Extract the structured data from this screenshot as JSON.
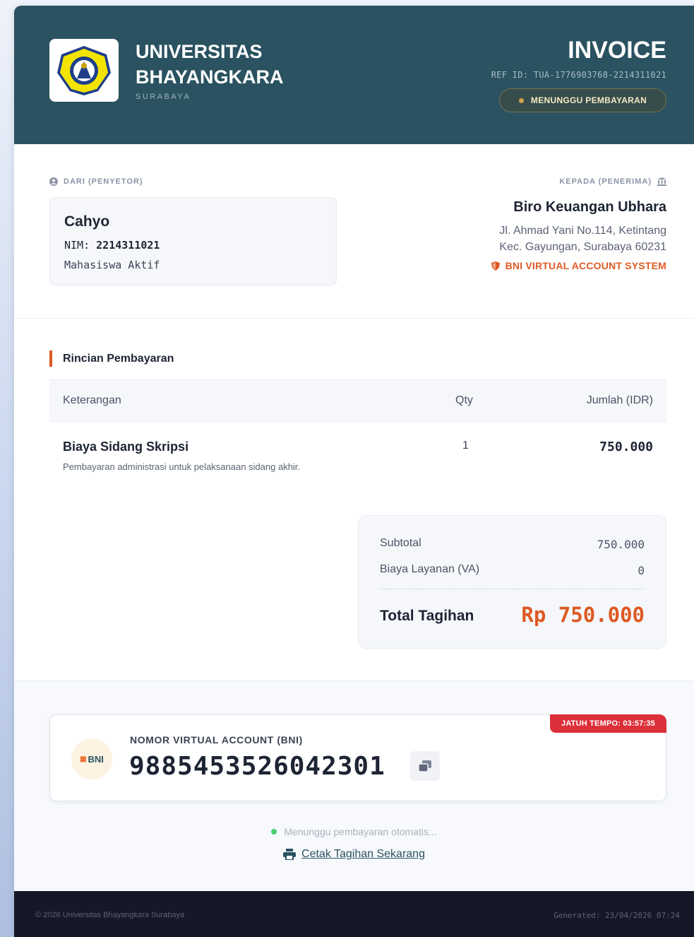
{
  "header": {
    "university_name": "UNIVERSITAS BHAYANGKARA",
    "university_city": "SURABAYA",
    "invoice_title": "INVOICE",
    "ref_id": "REF ID: TUA-1776903768-2214311021",
    "status": "MENUNGGU PEMBAYARAN"
  },
  "from": {
    "label": "DARI (PENYETOR)",
    "name": "Cahyo",
    "nim_label": "NIM:",
    "nim_value": "2214311021",
    "status": "Mahasiswa Aktif"
  },
  "to": {
    "label": "KEPADA (PENERIMA)",
    "name": "Biro Keuangan Ubhara",
    "address_line1": "Jl. Ahmad Yani No.114, Ketintang",
    "address_line2": "Kec. Gayungan, Surabaya 60231",
    "system": "BNI VIRTUAL ACCOUNT SYSTEM"
  },
  "details": {
    "section_title": "Rincian Pembayaran",
    "columns": [
      "Keterangan",
      "Qty",
      "Jumlah (IDR)"
    ],
    "items": [
      {
        "name": "Biaya Sidang Skripsi",
        "note": "Pembayaran administrasi untuk pelaksanaan sidang akhir.",
        "qty": "1",
        "amount": "750.000"
      }
    ]
  },
  "summary": {
    "subtotal_label": "Subtotal",
    "subtotal_value": "750.000",
    "fee_label": "Biaya Layanan (VA)",
    "fee_value": "0",
    "total_label": "Total Tagihan",
    "total_value": "Rp 750.000"
  },
  "va": {
    "due_badge": "JATUH TEMPO: 03:57:35",
    "bank_logo_text": "BNI",
    "label": "NOMOR VIRTUAL ACCOUNT (BNI)",
    "number": "9885453526042301",
    "waiting_text": "Menunggu pembayaran otomatis...",
    "print_label": "Cetak Tagihan Sekarang"
  },
  "footer": {
    "copyright": "© 2026 Universitas Bhayangkara Surabaya",
    "generated": "Generated: 23/04/2026 07:24"
  },
  "colors": {
    "header_bg": "#2a5260",
    "accent": "#dd5a23",
    "due_badge": "#dc2f3a",
    "footer_bg": "#161827",
    "status_dot": "#d0a24a",
    "wait_dot": "#4ccf74"
  },
  "icons": {
    "logo": "university-emblem-icon",
    "from": "user-circle-icon",
    "to": "bank-icon",
    "system": "shield-icon",
    "copy": "copy-icon",
    "print": "printer-icon"
  }
}
